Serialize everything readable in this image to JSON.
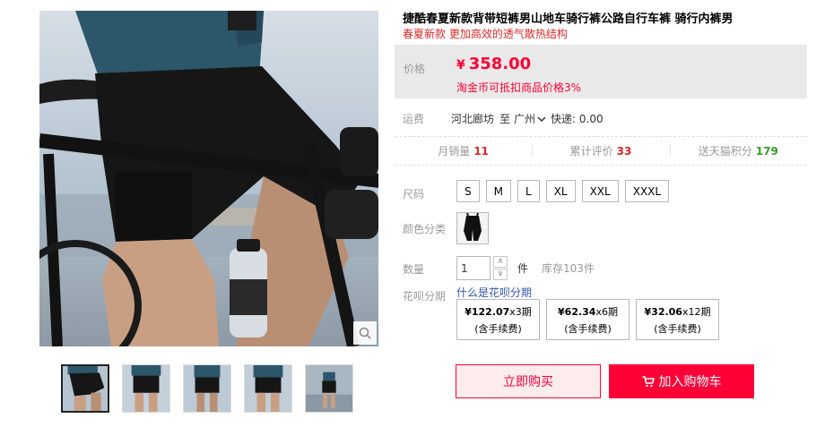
{
  "product": {
    "title": "捷酷春夏新款背带短裤男山地车骑行裤公路自行车裤 骑行内裤男",
    "subtitle": "春夏新款 更加高效的透气散热结构"
  },
  "gallery": {
    "active_index": 0,
    "thumbnail_count": 5
  },
  "price": {
    "label": "价格",
    "currency": "¥",
    "value": "358.00",
    "note": "淘金币可抵扣商品价格3%"
  },
  "shipping": {
    "label": "运费",
    "from": "河北廊坊",
    "to_label": "至",
    "to": "广州",
    "fee": "快递: 0.00"
  },
  "stats": {
    "monthly_sales_label": "月销量",
    "monthly_sales": "11",
    "reviews_label": "累计评价",
    "reviews": "33",
    "points_label": "送天猫积分",
    "points": "179"
  },
  "options": {
    "size_label": "尺码",
    "sizes": [
      "S",
      "M",
      "L",
      "XL",
      "XXL",
      "XXXL"
    ],
    "color_label": "颜色分类",
    "quantity_label": "数量",
    "quantity_value": "1",
    "quantity_up": "∧",
    "quantity_down": "∨",
    "quantity_unit": "件",
    "stock": "库存103件"
  },
  "huabei": {
    "label": "花呗分期",
    "link": "什么是花呗分期",
    "plans": [
      {
        "amount": "¥122.07",
        "term": "x3期",
        "fee": "(含手续费)"
      },
      {
        "amount": "¥62.34",
        "term": "x6期",
        "fee": "(含手续费)"
      },
      {
        "amount": "¥32.06",
        "term": "x12期",
        "fee": "(含手续费)"
      }
    ]
  },
  "actions": {
    "buy_now": "立即购买",
    "add_to_cart": "加入购物车"
  },
  "colors": {
    "accent": "#ff0036",
    "title_red": "#dd2727",
    "link_blue": "#3355aa",
    "points_green": "#3c9a2b"
  },
  "icons": [
    "zoom-icon",
    "chevron-down-icon",
    "cart-icon"
  ]
}
